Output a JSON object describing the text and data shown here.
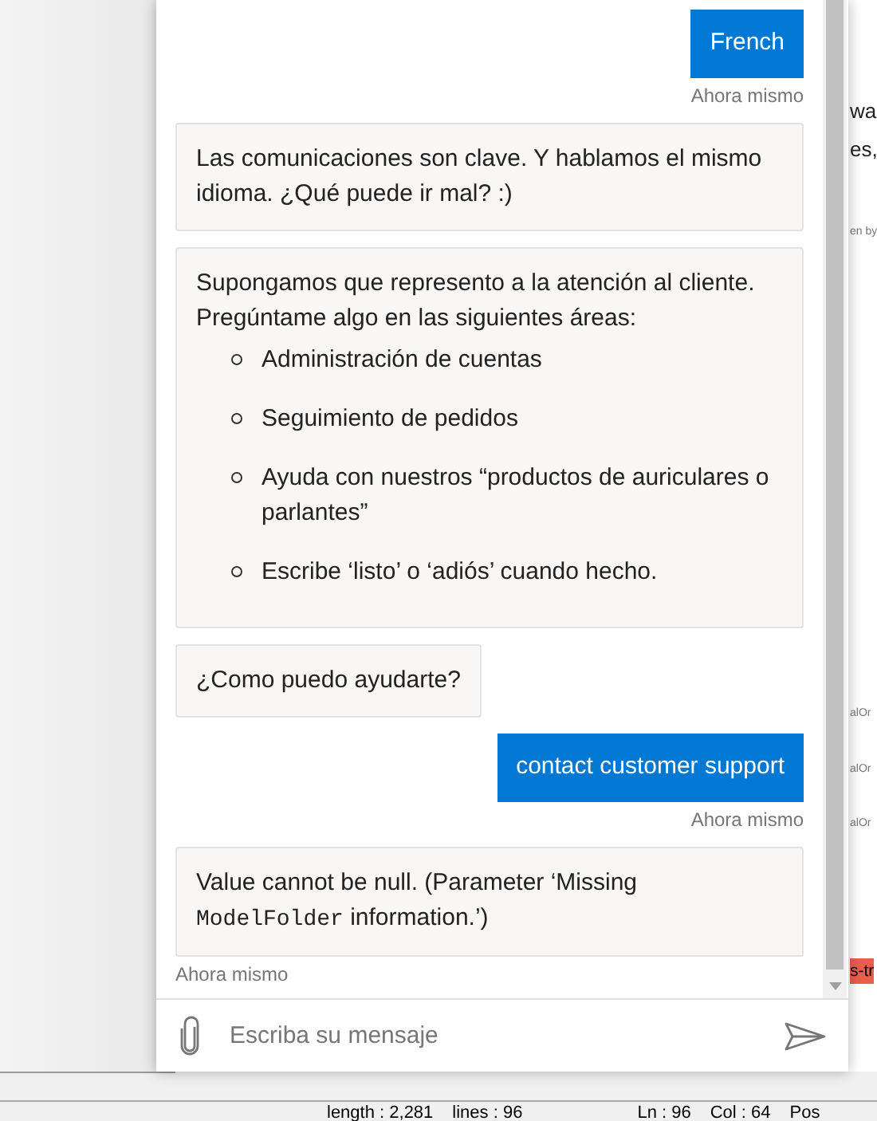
{
  "background": {
    "fragments": [
      {
        "text": "wa",
        "kind": "text"
      },
      {
        "text": "es,",
        "kind": "text"
      },
      {
        "text": "en by",
        "kind": "small"
      },
      {
        "text": "alOr",
        "kind": "small"
      },
      {
        "text": "alOr",
        "kind": "small"
      },
      {
        "text": "alOr",
        "kind": "small"
      },
      {
        "text": "s-tr",
        "kind": "tag"
      }
    ]
  },
  "chat": {
    "messages": [
      {
        "kind": "user",
        "text": "French",
        "time": "Ahora mismo"
      },
      {
        "kind": "bot",
        "paragraphs": [
          "Las comunicaciones son clave. Y hablamos el mismo idioma. ¿Qué puede ir mal? :)"
        ]
      },
      {
        "kind": "bot",
        "paragraphs": [
          "Supongamos que represento a la atención al cliente. Pregúntame algo en las siguientes áreas:"
        ],
        "list": [
          "Administración de cuentas",
          "Seguimiento de pedidos",
          "Ayuda con nuestros “productos de auriculares o parlantes”",
          "Escribe ‘listo’ o ‘adiós’ cuando hecho."
        ]
      },
      {
        "kind": "bot",
        "paragraphs": [
          "¿Como puedo ayudarte?"
        ]
      },
      {
        "kind": "user",
        "text": "contact customer support",
        "time": "Ahora mismo"
      },
      {
        "kind": "bot",
        "segments": [
          {
            "kind": "text",
            "text": "Value cannot be null. (Parameter ‘Missing "
          },
          {
            "kind": "code",
            "text": "ModelFolder"
          },
          {
            "kind": "text",
            "text": " information.’)"
          }
        ],
        "time": "Ahora mismo"
      }
    ],
    "input": {
      "placeholder": "Escriba su mensaje"
    }
  },
  "status_bar": {
    "length": "length : 2,281",
    "lines": "lines : 96",
    "ln": "Ln : 96",
    "col": "Col : 64",
    "pos": "Pos"
  }
}
